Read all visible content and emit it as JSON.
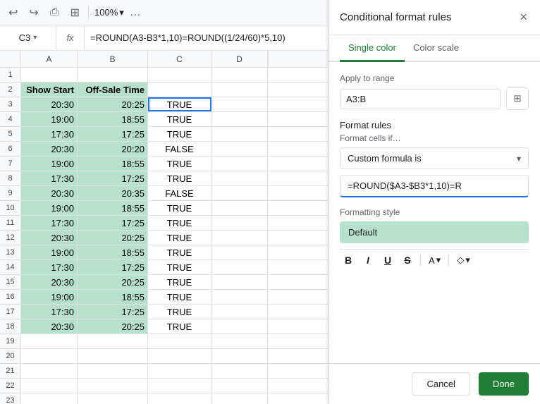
{
  "toolbar": {
    "undo_icon": "↩",
    "redo_icon": "↪",
    "print_icon": "⎙",
    "format_icon": "⊞",
    "zoom": "100%",
    "zoom_arrow": "▾",
    "more_icon": "…"
  },
  "formula_bar": {
    "cell_ref": "C3",
    "cell_ref_arrow": "▾",
    "fx": "fx",
    "formula": "=ROUND(A3-B3*1,10)=ROUND((1/24/60)*5,10)"
  },
  "grid": {
    "col_headers": [
      "A",
      "B",
      "C",
      "D"
    ],
    "rows": [
      {
        "num": 1,
        "cells": [
          "",
          "",
          "",
          ""
        ]
      },
      {
        "num": 2,
        "cells": [
          "Show Start",
          "Off-Sale Time",
          "",
          ""
        ]
      },
      {
        "num": 3,
        "cells": [
          "20:30",
          "20:25",
          "TRUE",
          ""
        ],
        "selected_col": 2
      },
      {
        "num": 4,
        "cells": [
          "19:00",
          "18:55",
          "TRUE",
          ""
        ]
      },
      {
        "num": 5,
        "cells": [
          "17:30",
          "17:25",
          "TRUE",
          ""
        ]
      },
      {
        "num": 6,
        "cells": [
          "20:30",
          "20:20",
          "FALSE",
          ""
        ]
      },
      {
        "num": 7,
        "cells": [
          "19:00",
          "18:55",
          "TRUE",
          ""
        ]
      },
      {
        "num": 8,
        "cells": [
          "17:30",
          "17:25",
          "TRUE",
          ""
        ]
      },
      {
        "num": 9,
        "cells": [
          "20:30",
          "20:35",
          "FALSE",
          ""
        ]
      },
      {
        "num": 10,
        "cells": [
          "19:00",
          "18:55",
          "TRUE",
          ""
        ]
      },
      {
        "num": 11,
        "cells": [
          "17:30",
          "17:25",
          "TRUE",
          ""
        ]
      },
      {
        "num": 12,
        "cells": [
          "20:30",
          "20:25",
          "TRUE",
          ""
        ]
      },
      {
        "num": 13,
        "cells": [
          "19:00",
          "18:55",
          "TRUE",
          ""
        ]
      },
      {
        "num": 14,
        "cells": [
          "17:30",
          "17:25",
          "TRUE",
          ""
        ]
      },
      {
        "num": 15,
        "cells": [
          "20:30",
          "20:25",
          "TRUE",
          ""
        ]
      },
      {
        "num": 16,
        "cells": [
          "19:00",
          "18:55",
          "TRUE",
          ""
        ]
      },
      {
        "num": 17,
        "cells": [
          "17:30",
          "17:25",
          "TRUE",
          ""
        ]
      },
      {
        "num": 18,
        "cells": [
          "20:30",
          "20:25",
          "TRUE",
          ""
        ]
      },
      {
        "num": 19,
        "cells": [
          "",
          "",
          "",
          ""
        ]
      },
      {
        "num": 20,
        "cells": [
          "",
          "",
          "",
          ""
        ]
      },
      {
        "num": 21,
        "cells": [
          "",
          "",
          "",
          ""
        ]
      },
      {
        "num": 22,
        "cells": [
          "",
          "",
          "",
          ""
        ]
      },
      {
        "num": 23,
        "cells": [
          "",
          "",
          "",
          ""
        ]
      }
    ]
  },
  "panel": {
    "title": "Conditional format rules",
    "close_icon": "×",
    "tabs": [
      {
        "label": "Single color",
        "active": true
      },
      {
        "label": "Color scale",
        "active": false
      }
    ],
    "apply_to_range_label": "Apply to range",
    "range_value": "A3:B",
    "grid_icon": "⊞",
    "format_rules_label": "Format rules",
    "format_cells_if_label": "Format cells if…",
    "dropdown_value": "Custom formula is",
    "dropdown_arrow": "▾",
    "formula_value": "=ROUND($A3-$B3*1,10)=R",
    "formatting_style_label": "Formatting style",
    "style_preview": "Default",
    "style_btns": {
      "bold": "B",
      "italic": "I",
      "underline": "U",
      "strikethrough": "S",
      "font_color": "A",
      "fill_color": "◇"
    },
    "cancel_label": "Cancel",
    "done_label": "Done"
  }
}
